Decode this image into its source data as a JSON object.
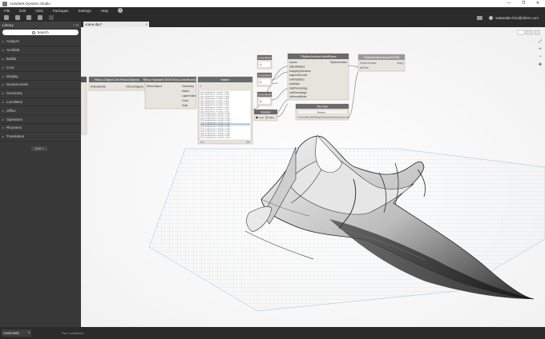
{
  "window": {
    "title": "Autodesk Dynamo Studio",
    "controls": [
      "—",
      "❐",
      "✕"
    ]
  },
  "menu": {
    "items": [
      "File",
      "Edit",
      "View",
      "Packages",
      "Settings",
      "Help"
    ],
    "help_badge": "?"
  },
  "toolbar": {
    "user": "watanabe.hiro@dimm.com"
  },
  "library": {
    "title": "Library",
    "controls": "≡ ⊟",
    "search_placeholder": "Search",
    "categories": [
      "Analyze",
      "Archilab",
      "Builtin",
      "Core",
      "Display",
      "DynamoUnits",
      "Geometry",
      "LunchBox",
      "Office",
      "Operators",
      "Rhynamo",
      "Translation"
    ],
    "add_label": "Add"
  },
  "tab": {
    "label": "crane.dyn*",
    "close": "×"
  },
  "nodes": {
    "rhino_object": {
      "title": "Rhino.Object.Get.RhinoObjects",
      "inputs": [
        "RhinoModel"
      ],
      "outputs": [
        "RhinoObjects"
      ]
    },
    "rhino_translate": {
      "title": "Rhino.Translate.ToDS.Rhino.Line2NurbsDs",
      "inputs": [
        "RhinoObject"
      ],
      "outputs": [
        "Geometry",
        "Name",
        "Layer.Index",
        "Color",
        "Guid"
      ]
    },
    "watch": {
      "title": "Watch",
      "input": ">",
      "rows": [
        "[0] Line(StartPoint = Point(X = 0.000,",
        "[1] Line(StartPoint = Point(X = 0.000,",
        "[2] Line(StartPoint = Point(X = 0.000,",
        "[3] Line(StartPoint = Point(X = 0.000,",
        "[4] Line(StartPoint = Point(X = 0.000,",
        "[5] Line(StartPoint = Point(X = 0.000,",
        "[6] Line(StartPoint = Point(X = 0.000,",
        "[7] Line(StartPoint = Point(X = 0.000,",
        "[8] Line(StartPoint = Point(X = 0.000,",
        "[9] Line(StartPoint = Point(X = 0.000,",
        "[10] Line(StartPoint = Point(X = 0.000,",
        "[11] Line(StartPoint = Point(X = 0.000,",
        "[12] Line(StartPoint = Point(X = 0.000,",
        "[13] Line(StartPoint = Point(X = 0.000,",
        "[14] Line(StartPoint = Point(X = 0.000,",
        "[15] Line(StartPoint = Point(X = 0.000,",
        "[16] Line(StartPoint = Point(X = 0.000,",
        "[17] Line(StartPoint = Point(X = 0.000,",
        "[18] Line(StartPoint = Point(X = 0.000,",
        "[19] Line(StartPoint = Point(X = 0.000,",
        "[20] Line(StartPoint = Point(X = 0.000,",
        "[21] Line(StartPoint = Point(X = 0.000,"
      ],
      "footer_left": "List",
      "footer_right": "{21}"
    },
    "code_block_1": {
      "title": "Code Block",
      "value": "4;"
    },
    "code_block_2": {
      "title": "Code Block",
      "value": "6;"
    },
    "code_block_3": {
      "title": "Code Block",
      "value": "8;"
    },
    "boolean": {
      "title": "Boolean",
      "true_label": "True",
      "false_label": "False"
    },
    "tsp_build": {
      "title": "TSplineSurface.BuildPipes",
      "inputs": [
        "curves",
        "defaultRadius",
        "snappingTolerance",
        "segmentsCount",
        "endRotations",
        "endRadii",
        "startPercentage",
        "endPercentage",
        "inSmoothMode"
      ],
      "outputs": [
        "TSplineSurface"
      ]
    },
    "tsp_export": {
      "title": "TSplineSurface.ExportToTSM",
      "inputs": [
        "tSplineSurface",
        "filePath"
      ],
      "outputs": [
        "string"
      ]
    },
    "file_path": {
      "title": "File Path",
      "button": "Browse...",
      "value": "C:\\Users\\Hiroshi\\Desktop\\Dynamo\\Downloads\\crane.tsm"
    }
  },
  "status": {
    "run_mode": "Automatic",
    "run_label": "Run completed."
  }
}
